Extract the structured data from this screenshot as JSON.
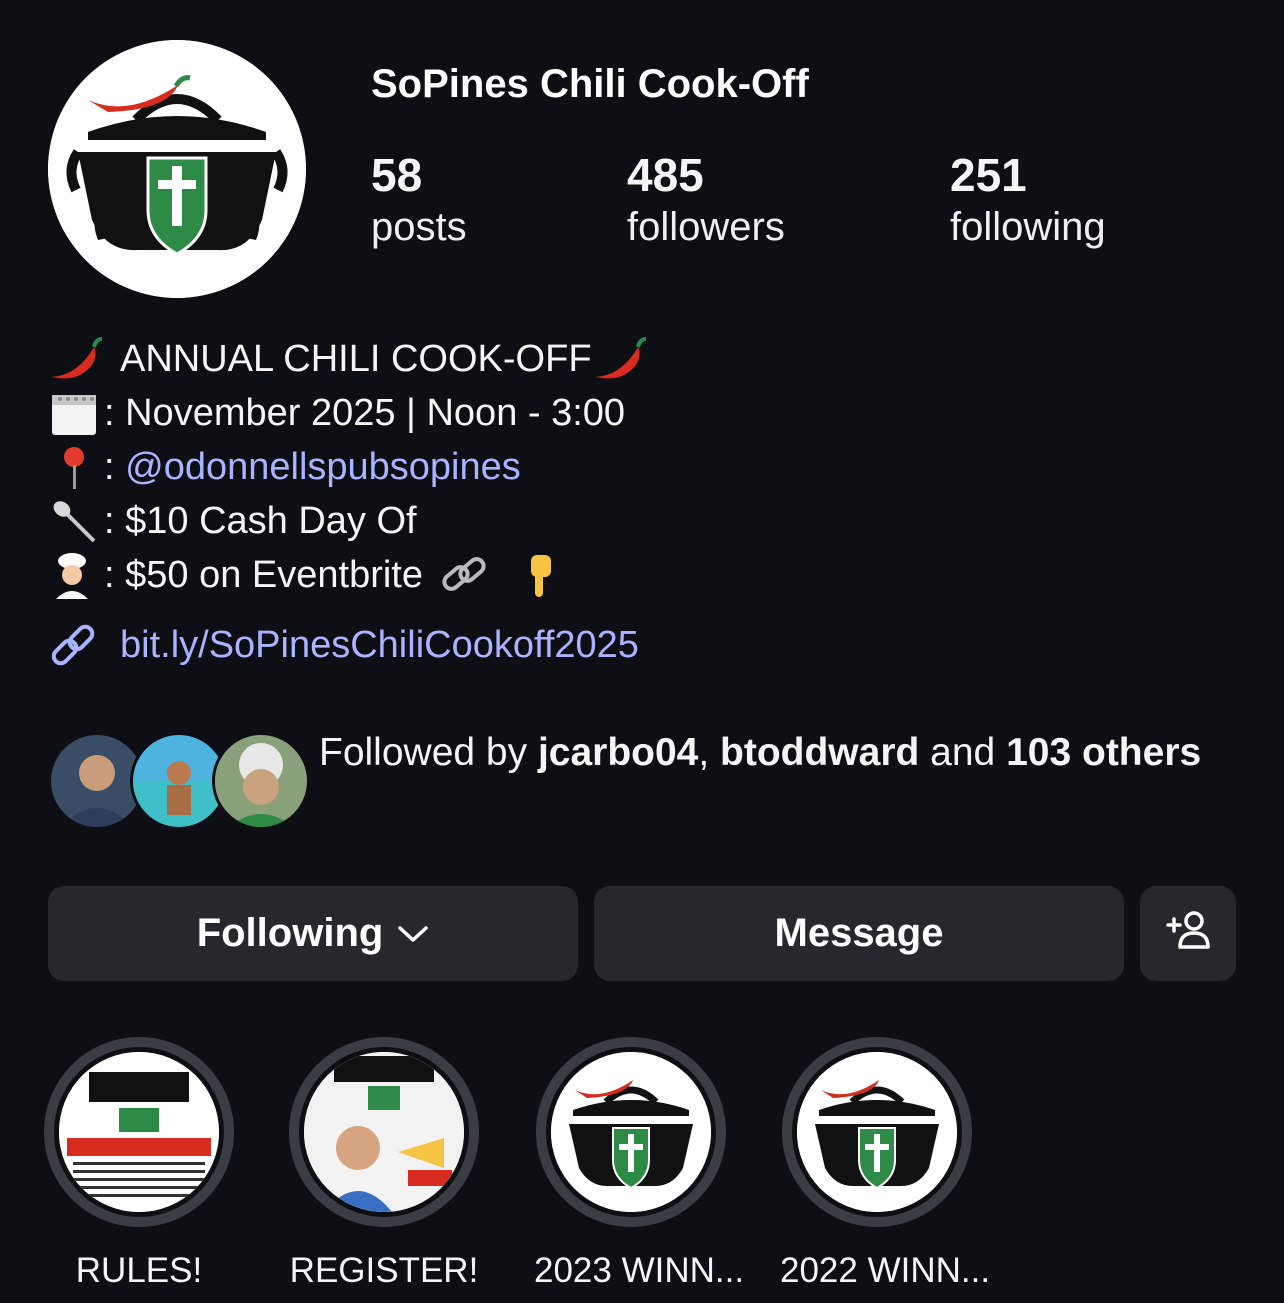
{
  "profile": {
    "name": "SoPines Chili Cook-Off",
    "stats": {
      "posts": {
        "count": "58",
        "label": "posts"
      },
      "followers": {
        "count": "485",
        "label": "followers"
      },
      "following": {
        "count": "251",
        "label": "following"
      }
    }
  },
  "bio": {
    "line1": "ANNUAL CHILI COOK-OFF",
    "line2": ": November 2025 | Noon - 3:00",
    "line3_prefix": ": ",
    "line3_mention": "@odonnellspubsopines",
    "line4": ": $10 Cash Day Of",
    "line5": ": $50 on Eventbrite",
    "link": "bit.ly/SoPinesChiliCookoff2025",
    "icons": [
      "chili-pepper-icon",
      "calendar-icon",
      "pin-icon",
      "spoon-icon",
      "chef-icon",
      "chain-link-icon",
      "pointing-down-icon",
      "link-icon"
    ]
  },
  "followed_by": {
    "prefix": "Followed by ",
    "user1": "jcarbo04",
    "sep": ", ",
    "user2": "btoddward",
    "and": " and ",
    "others": "103 others"
  },
  "actions": {
    "following_label": "Following",
    "message_label": "Message"
  },
  "highlights": [
    {
      "label": "RULES!"
    },
    {
      "label": "REGISTER!"
    },
    {
      "label": "2023 WINN..."
    },
    {
      "label": "2022 WINN..."
    }
  ],
  "colors": {
    "background": "#0e0f14",
    "button": "#26282e",
    "link": "#a8b4ff",
    "shield": "#2e8b46",
    "pepper": "#d62b1f"
  }
}
